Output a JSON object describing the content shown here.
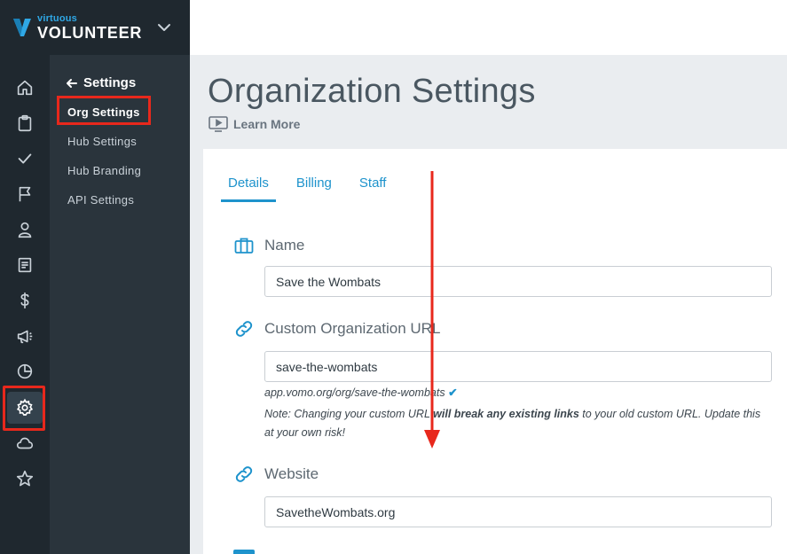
{
  "brand": {
    "small": "virtuous",
    "big": "VOLUNTEER",
    "accent": "#2fa8e6"
  },
  "rail": {
    "icons": [
      "home-icon",
      "clipboard-icon",
      "check-icon",
      "flag-icon",
      "person-icon",
      "document-icon",
      "dollar-icon",
      "megaphone-icon",
      "pie-chart-icon",
      "gear-icon",
      "cloud-icon",
      "star-icon"
    ],
    "active": "gear-icon"
  },
  "subnav": {
    "back_label": "Settings",
    "items": [
      "Org Settings",
      "Hub Settings",
      "Hub Branding",
      "API Settings"
    ],
    "active": "Org Settings"
  },
  "page": {
    "title": "Organization Settings",
    "learn_more": "Learn More"
  },
  "tabs": [
    "Details",
    "Billing",
    "Staff"
  ],
  "active_tab": "Details",
  "fields": {
    "name": {
      "label": "Name",
      "value": "Save the Wombats"
    },
    "custom_url": {
      "label": "Custom Organization URL",
      "value": "save-the-wombats",
      "preview": "app.vomo.org/org/save-the-wombats",
      "check": "✔",
      "note_prefix": "Note: Changing your custom URL ",
      "note_bold": "will break any existing links",
      "note_suffix": " to your old custom URL. Update this at your own risk!"
    },
    "website": {
      "label": "Website",
      "value": "SavetheWombats.org"
    }
  },
  "colors": {
    "sidebar": "#1f282f",
    "subnav": "#2a343c",
    "link": "#1e93cc",
    "annotation": "#e8281c"
  }
}
